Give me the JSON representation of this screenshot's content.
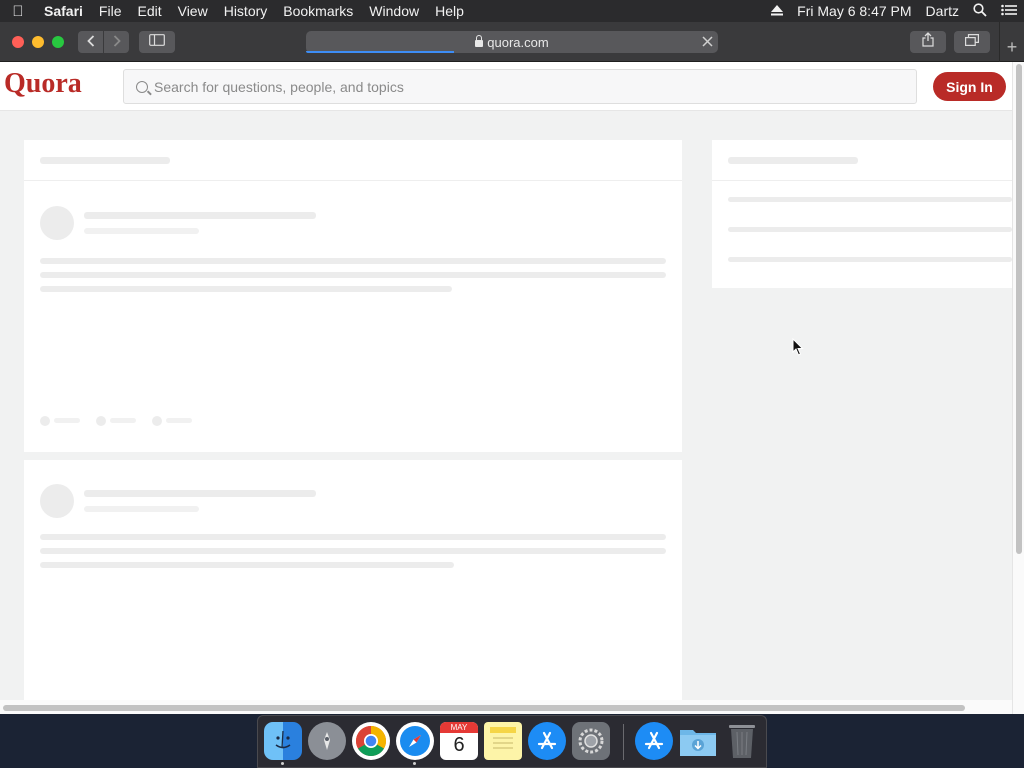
{
  "menubar": {
    "app_name": "Safari",
    "menus": [
      "File",
      "Edit",
      "View",
      "History",
      "Bookmarks",
      "Window",
      "Help"
    ],
    "datetime": "Fri May 6  8:47 PM",
    "user": "Dartz",
    "icons": [
      "apple-icon",
      "eject-icon",
      "spotlight-icon",
      "control-center-icon"
    ]
  },
  "browser": {
    "url": "quora.com",
    "page_load_fraction": 0.36,
    "icons": [
      "back-icon",
      "forward-icon",
      "sidebar-icon",
      "share-icon",
      "tabs-icon",
      "new-tab-icon",
      "lock-icon",
      "stop-icon"
    ]
  },
  "quora": {
    "logo": "Quora",
    "search_placeholder": "Search for questions, people, and topics",
    "signin_label": "Sign In",
    "brand_color": "#b92b27"
  },
  "dock": {
    "apps": [
      "Finder",
      "Launchpad",
      "Google Chrome",
      "Safari",
      "Calendar",
      "Notes",
      "App Store",
      "System Preferences",
      "App Store",
      "Downloads",
      "Trash"
    ],
    "calendar_month": "MAY",
    "calendar_day": "6"
  }
}
